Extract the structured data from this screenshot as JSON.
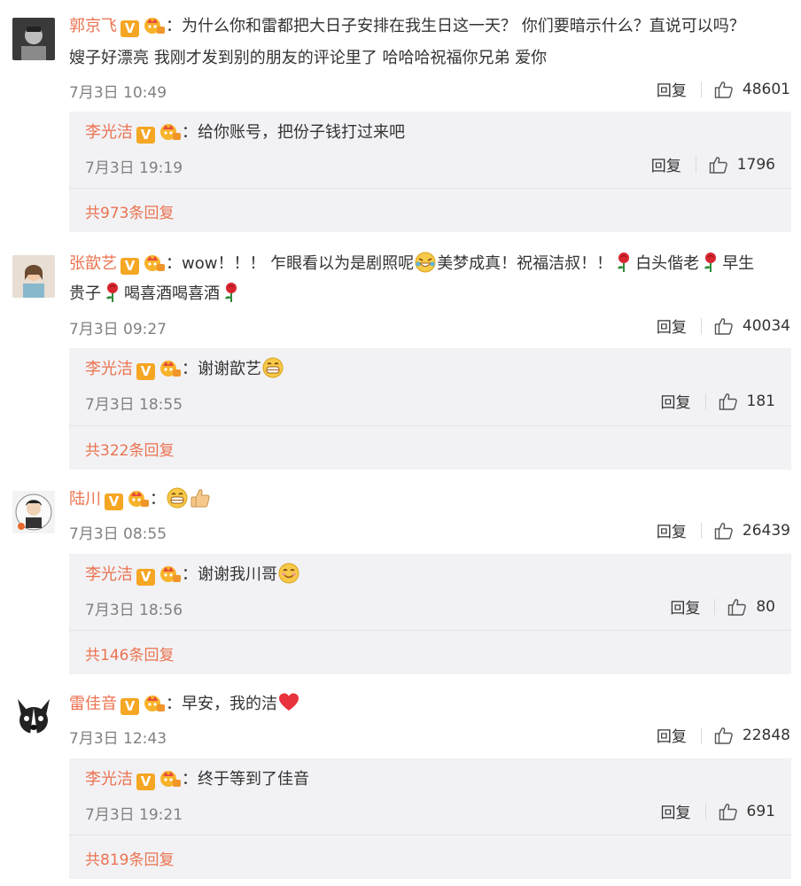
{
  "comments": [
    {
      "name": "郭京飞",
      "text1": "：为什么你和雷都把大日子安排在我生日这一天？ 你们要暗示什么？直说可以吗？",
      "text2": "嫂子好漂亮 我刚才发到别的朋友的评论里了 哈哈哈祝福你兄弟 爱你",
      "time": "7月3日 10:49",
      "reply_label": "回复",
      "likes": "48601",
      "reply": {
        "name": "李光洁",
        "text": "：给你账号，把份子钱打过来吧",
        "time": "7月3日 19:19",
        "reply_label": "回复",
        "likes": "1796"
      },
      "more": "共973条回复"
    },
    {
      "name": "张歆艺",
      "text1a": "：wow！！！ 乍眼看以为是剧照呢",
      "text1b": "美梦成真！祝福洁叔！！",
      "text1c": "白头偕老",
      "text1d": "早生",
      "text2a": "贵子",
      "text2b": "喝喜酒喝喜酒",
      "time": "7月3日 09:27",
      "reply_label": "回复",
      "likes": "40034",
      "reply": {
        "name": "李光洁",
        "text": "：谢谢歆艺",
        "time": "7月3日 18:55",
        "reply_label": "回复",
        "likes": "181"
      },
      "more": "共322条回复"
    },
    {
      "name": "陆川",
      "text1": "：",
      "time": "7月3日 08:55",
      "reply_label": "回复",
      "likes": "26439",
      "reply": {
        "name": "李光洁",
        "text": "：谢谢我川哥",
        "time": "7月3日 18:56",
        "reply_label": "回复",
        "likes": "80"
      },
      "more": "共146条回复"
    },
    {
      "name": "雷佳音",
      "text1": "：早安，我的洁",
      "time": "7月3日 12:43",
      "reply_label": "回复",
      "likes": "22848",
      "reply": {
        "name": "李光洁",
        "text": "：终于等到了佳音",
        "time": "7月3日 19:21",
        "reply_label": "回复",
        "likes": "691"
      },
      "more": "共819条回复"
    }
  ],
  "badge_v": "V",
  "colors": {
    "name": "#eb7350",
    "badge": "#f5a623",
    "reply_bg": "#f2f2f5",
    "meta": "#808080"
  }
}
